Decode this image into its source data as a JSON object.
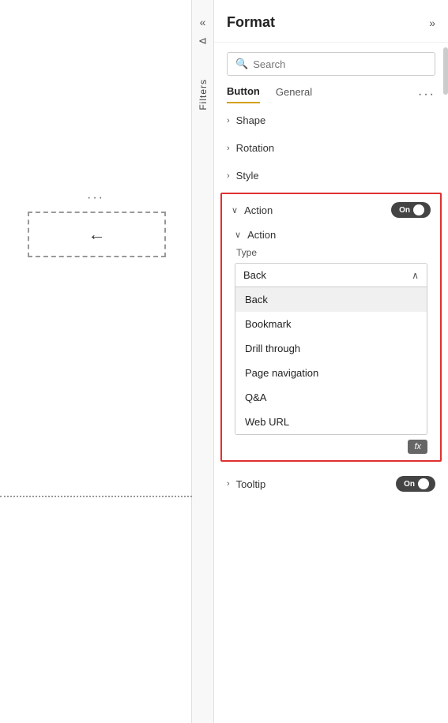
{
  "canvas": {
    "dots": "···",
    "arrow": "←"
  },
  "filters": {
    "label": "Filters"
  },
  "panel": {
    "title": "Format",
    "expand_icon": "»",
    "collapse_left": "«"
  },
  "search": {
    "placeholder": "Search"
  },
  "tabs": {
    "button_label": "Button",
    "general_label": "General",
    "more_icon": "···"
  },
  "sections": {
    "shape": "Shape",
    "rotation": "Rotation",
    "style": "Style"
  },
  "action": {
    "label": "Action",
    "toggle_label": "On",
    "sub_label": "Action",
    "type_label": "Type",
    "selected": "Back",
    "options": [
      "Back",
      "Bookmark",
      "Drill through",
      "Page navigation",
      "Q&A",
      "Web URL"
    ]
  },
  "fx": {
    "label": "fx"
  },
  "tooltip": {
    "label": "Tooltip",
    "toggle_label": "On"
  }
}
